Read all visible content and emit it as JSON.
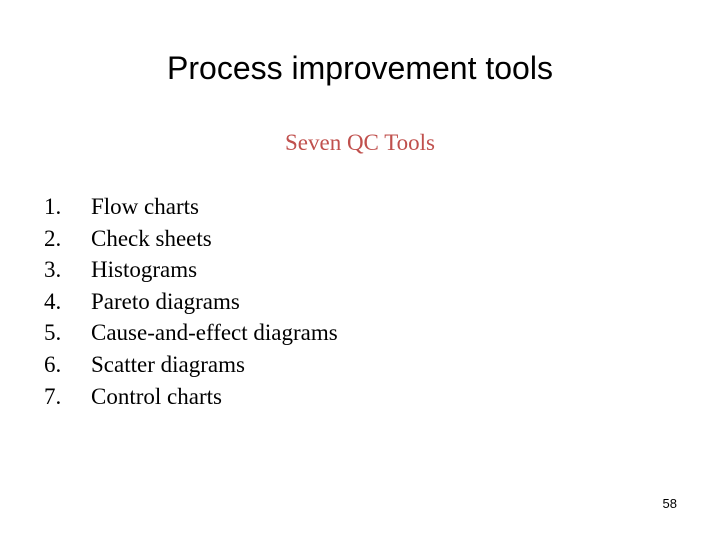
{
  "slide": {
    "title": "Process improvement tools",
    "subtitle": "Seven QC Tools",
    "subtitle_color": "#c0504d",
    "items": [
      {
        "number": "1.",
        "label": "Flow charts"
      },
      {
        "number": "2.",
        "label": "Check sheets"
      },
      {
        "number": "3.",
        "label": "Histograms"
      },
      {
        "number": "4.",
        "label": "Pareto diagrams"
      },
      {
        "number": "5.",
        "label": "Cause-and-effect diagrams"
      },
      {
        "number": "6.",
        "label": "Scatter diagrams"
      },
      {
        "number": "7.",
        "label": "Control charts"
      }
    ],
    "page_number": "58"
  }
}
